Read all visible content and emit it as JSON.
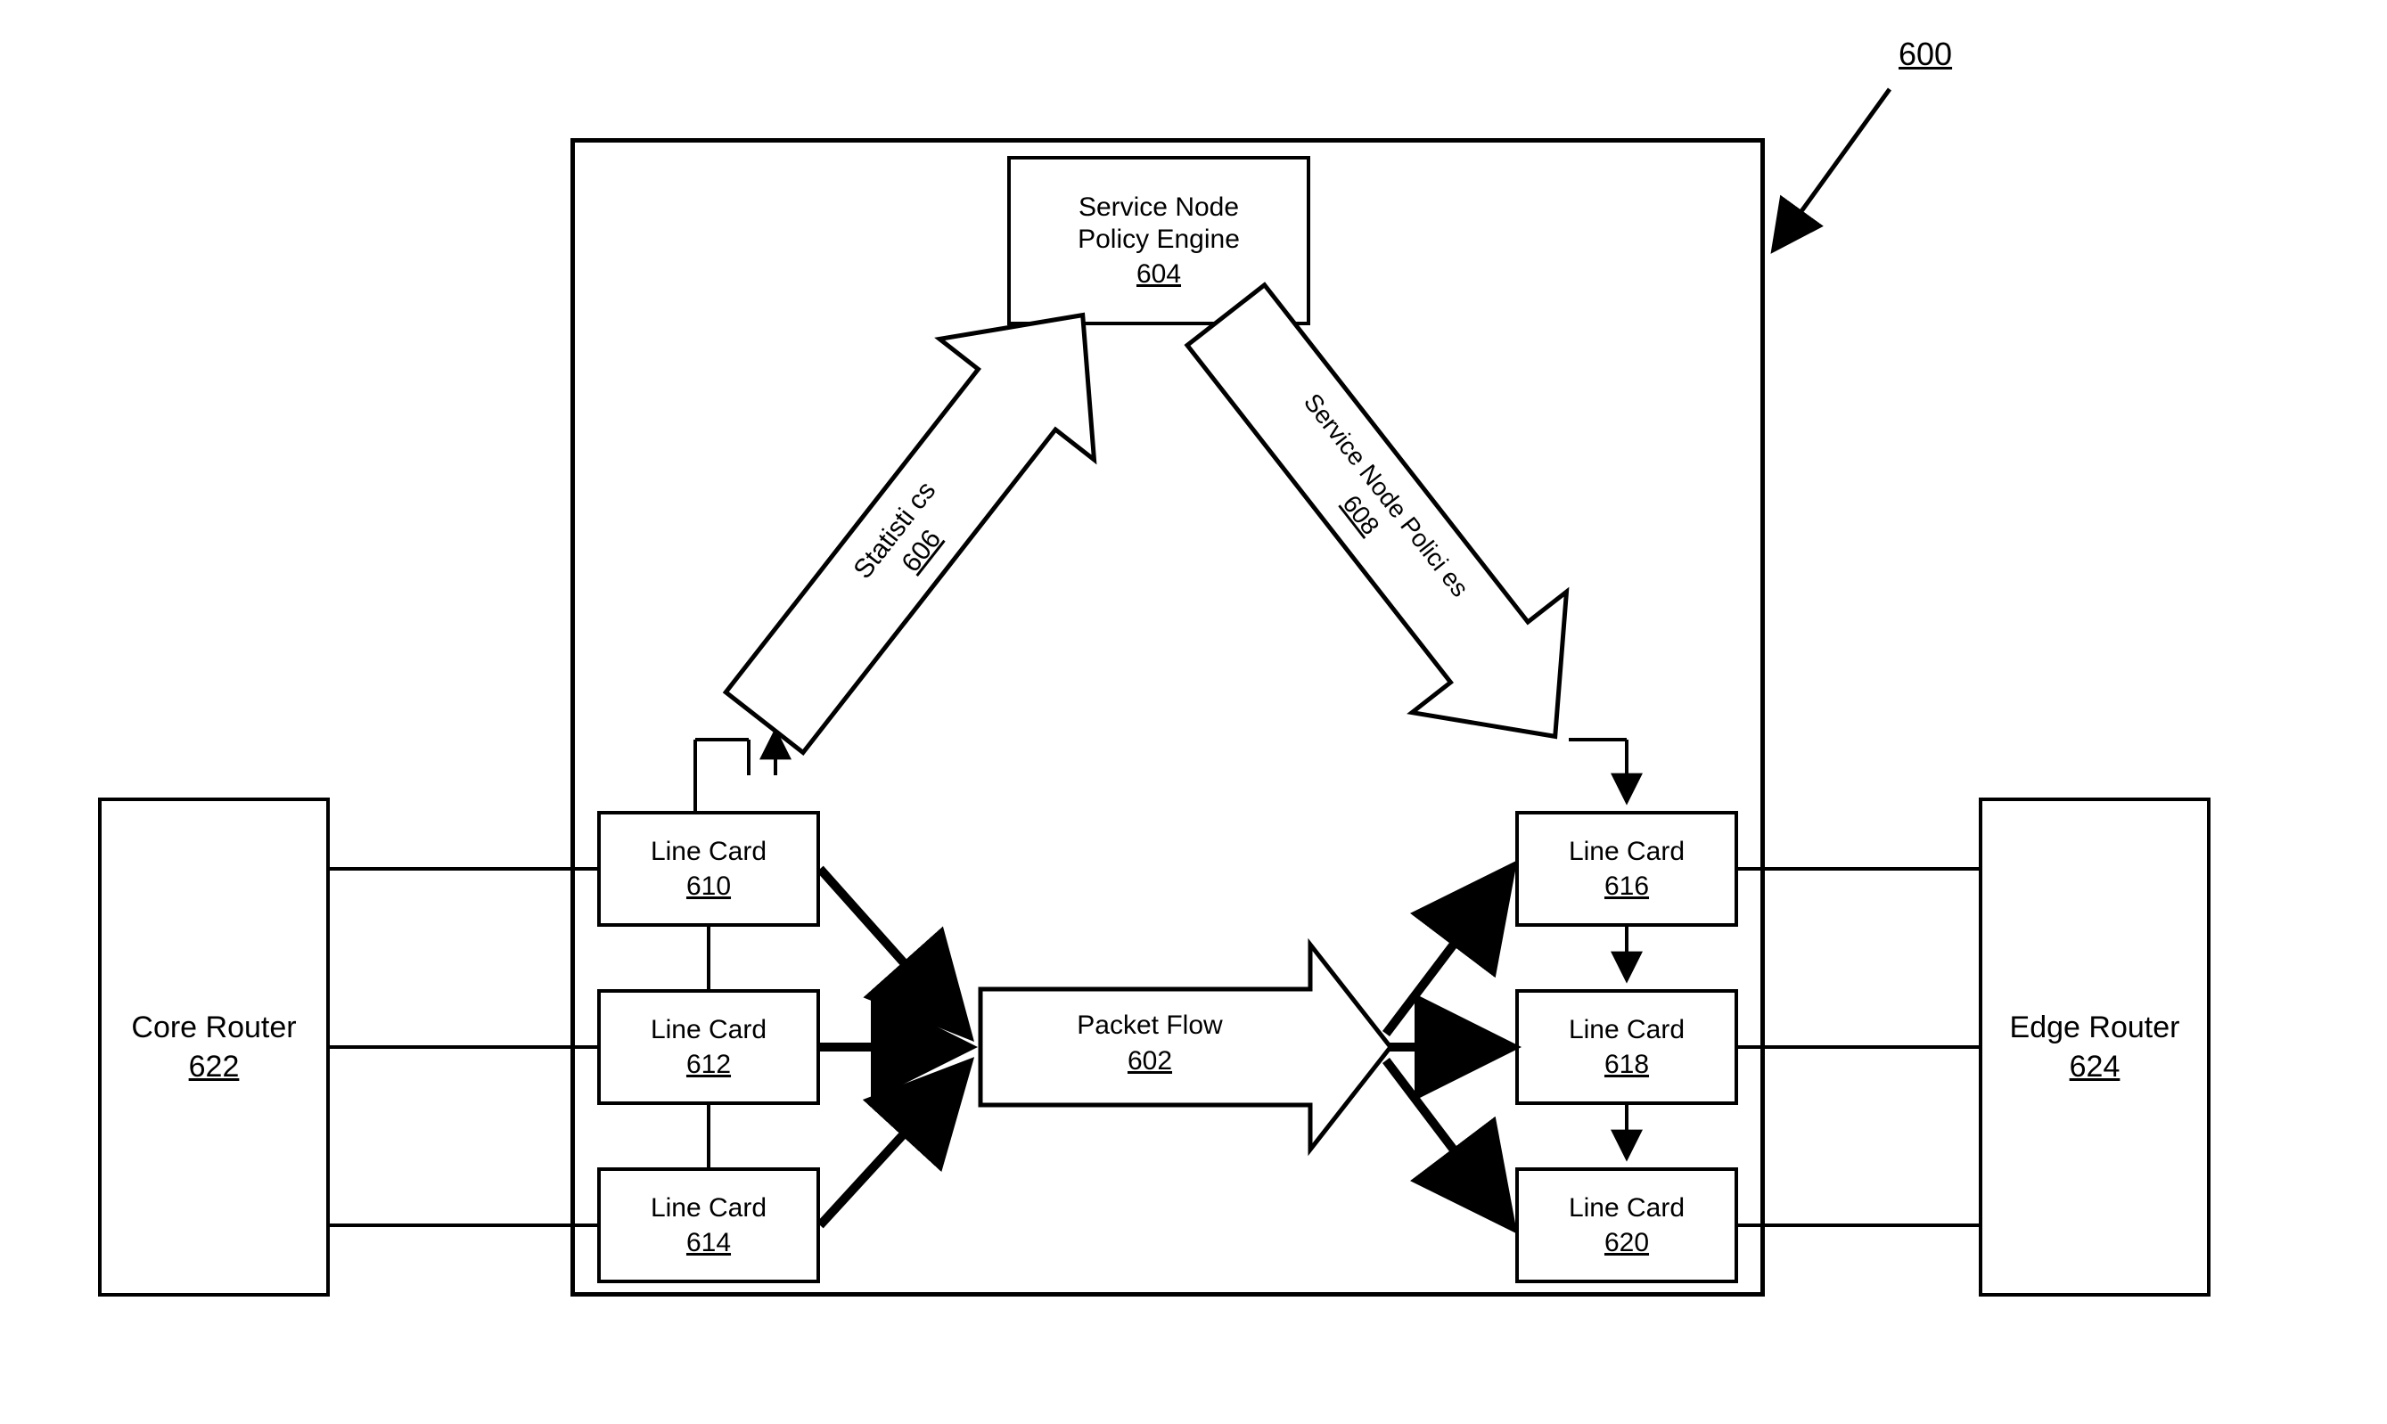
{
  "figure": {
    "label": "600"
  },
  "policyEngine": {
    "title": "Service Node\nPolicy Engine",
    "num": "604"
  },
  "statsArrow": {
    "label": "Statisti cs",
    "num": "606"
  },
  "policiesArrow": {
    "label": "Service Node Polici es",
    "num": "608"
  },
  "packetFlow": {
    "label": "Packet Flow",
    "num": "602"
  },
  "leftCards": [
    {
      "title": "Line Card",
      "num": "610"
    },
    {
      "title": "Line Card",
      "num": "612"
    },
    {
      "title": "Line Card",
      "num": "614"
    }
  ],
  "rightCards": [
    {
      "title": "Line Card",
      "num": "616"
    },
    {
      "title": "Line Card",
      "num": "618"
    },
    {
      "title": "Line Card",
      "num": "620"
    }
  ],
  "coreRouter": {
    "title": "Core Router",
    "num": "622"
  },
  "edgeRouter": {
    "title": "Edge Router",
    "num": "624"
  }
}
